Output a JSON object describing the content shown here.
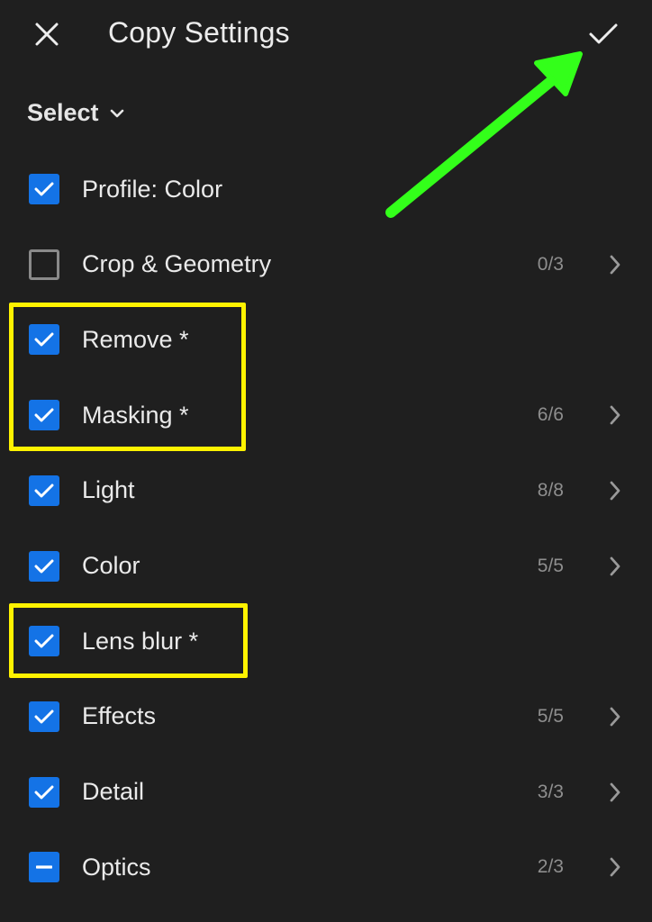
{
  "header": {
    "title": "Copy Settings",
    "close_icon": "close-icon",
    "confirm_icon": "checkmark-icon"
  },
  "select": {
    "label": "Select",
    "icon": "chevron-down-icon"
  },
  "items": [
    {
      "label": "Profile: Color",
      "state": "checked",
      "count": "",
      "has_arrow": false
    },
    {
      "label": "Crop & Geometry",
      "state": "unchecked",
      "count": "0/3",
      "has_arrow": true
    },
    {
      "label": "Remove *",
      "state": "checked",
      "count": "",
      "has_arrow": false
    },
    {
      "label": "Masking *",
      "state": "checked",
      "count": "6/6",
      "has_arrow": true
    },
    {
      "label": "Light",
      "state": "checked",
      "count": "8/8",
      "has_arrow": true
    },
    {
      "label": "Color",
      "state": "checked",
      "count": "5/5",
      "has_arrow": true
    },
    {
      "label": "Lens blur *",
      "state": "checked",
      "count": "",
      "has_arrow": false
    },
    {
      "label": "Effects",
      "state": "checked",
      "count": "5/5",
      "has_arrow": true
    },
    {
      "label": "Detail",
      "state": "checked",
      "count": "3/3",
      "has_arrow": true
    },
    {
      "label": "Optics",
      "state": "partial",
      "count": "2/3",
      "has_arrow": true
    }
  ],
  "colors": {
    "background": "#1f1f1f",
    "checkbox_accent": "#1473e6",
    "highlight": "#fff200",
    "annotation_arrow": "#33ff1a"
  }
}
